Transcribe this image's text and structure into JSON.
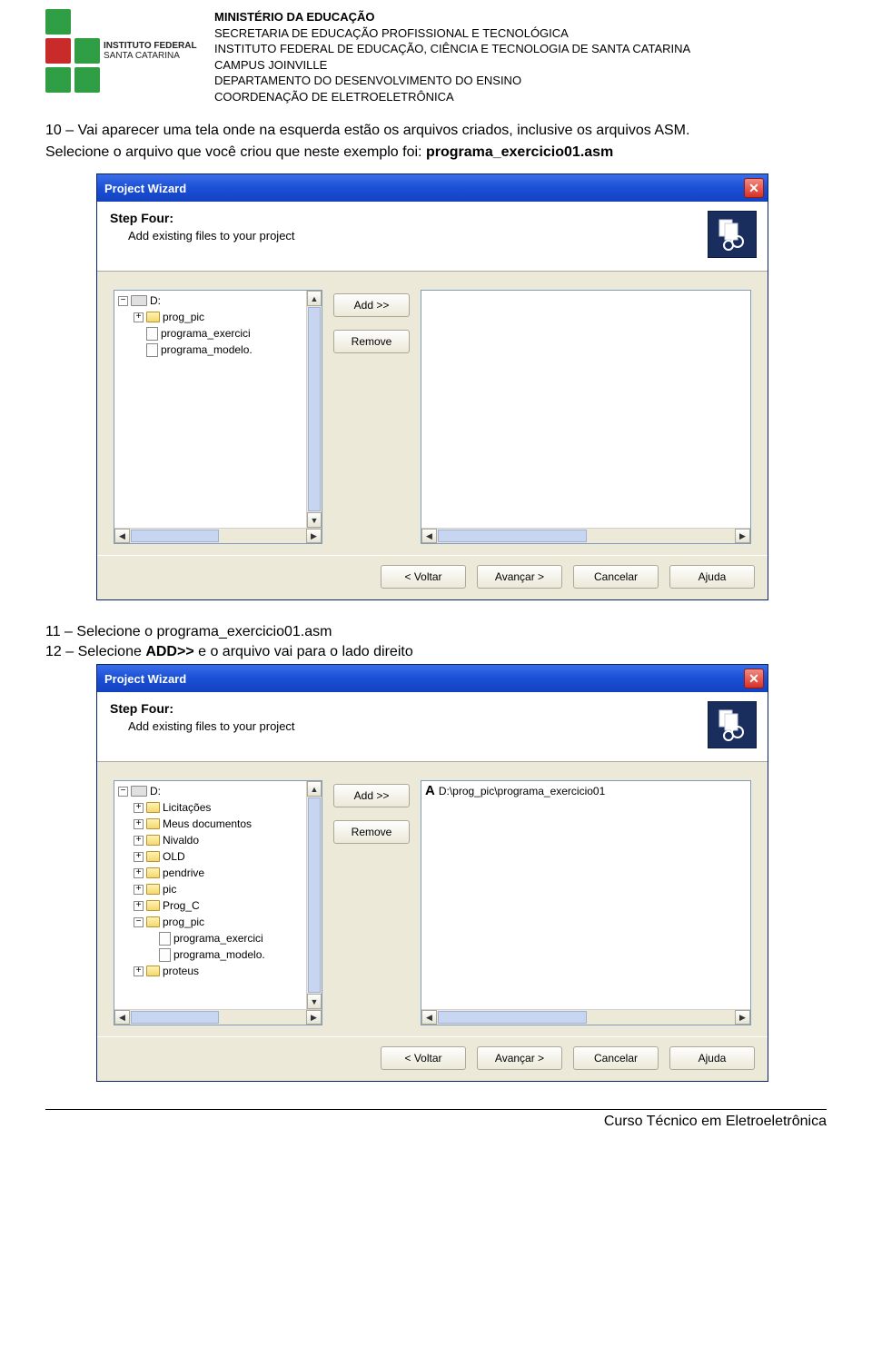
{
  "header": {
    "line1": "MINISTÉRIO DA EDUCAÇÃO",
    "line2": "SECRETARIA DE EDUCAÇÃO PROFISSIONAL E TECNOLÓGICA",
    "line3": "INSTITUTO FEDERAL DE EDUCAÇÃO, CIÊNCIA E TECNOLOGIA DE SANTA CATARINA",
    "line4": "CAMPUS JOINVILLE",
    "line5": "DEPARTAMENTO DO DESENVOLVIMENTO DO ENSINO",
    "line6": "COORDENAÇÃO DE ELETROELETRÔNICA"
  },
  "logo": {
    "line1": "INSTITUTO FEDERAL",
    "line2": "SANTA CATARINA"
  },
  "para10": "10 – Vai aparecer uma tela onde na esquerda estão os arquivos criados, inclusive os arquivos ASM.",
  "para10b_a": "Selecione o arquivo que você criou que neste exemplo foi: ",
  "para10b_b": "programa_exercicio01.asm",
  "wizard": {
    "title": "Project Wizard",
    "step_title": "Step Four:",
    "step_sub": "Add existing files to your project",
    "add": "Add >>",
    "remove": "Remove",
    "back": "< Voltar",
    "next": "Avançar >",
    "cancel": "Cancelar",
    "help": "Ajuda"
  },
  "tree1": {
    "drive": "D:",
    "folder": "prog_pic",
    "f1": "programa_exercici",
    "f2": "programa_modelo."
  },
  "tree2": {
    "drive": "D:",
    "items": [
      "Licitações",
      "Meus documentos",
      "Nivaldo",
      "OLD",
      "pendrive",
      "pic",
      "Prog_C",
      "prog_pic"
    ],
    "files": [
      "programa_exercici",
      "programa_modelo."
    ],
    "last": "proteus"
  },
  "result2": "D:\\prog_pic\\programa_exercicio01",
  "step11_a": "11 – Selecione o ",
  "step11_b": "programa_exercicio01.asm",
  "step12_a": "12 – Selecione ",
  "step12_b": "ADD>>",
  "step12_c": " e o arquivo vai para o lado direito",
  "footer": "Curso Técnico em Eletroeletrônica"
}
